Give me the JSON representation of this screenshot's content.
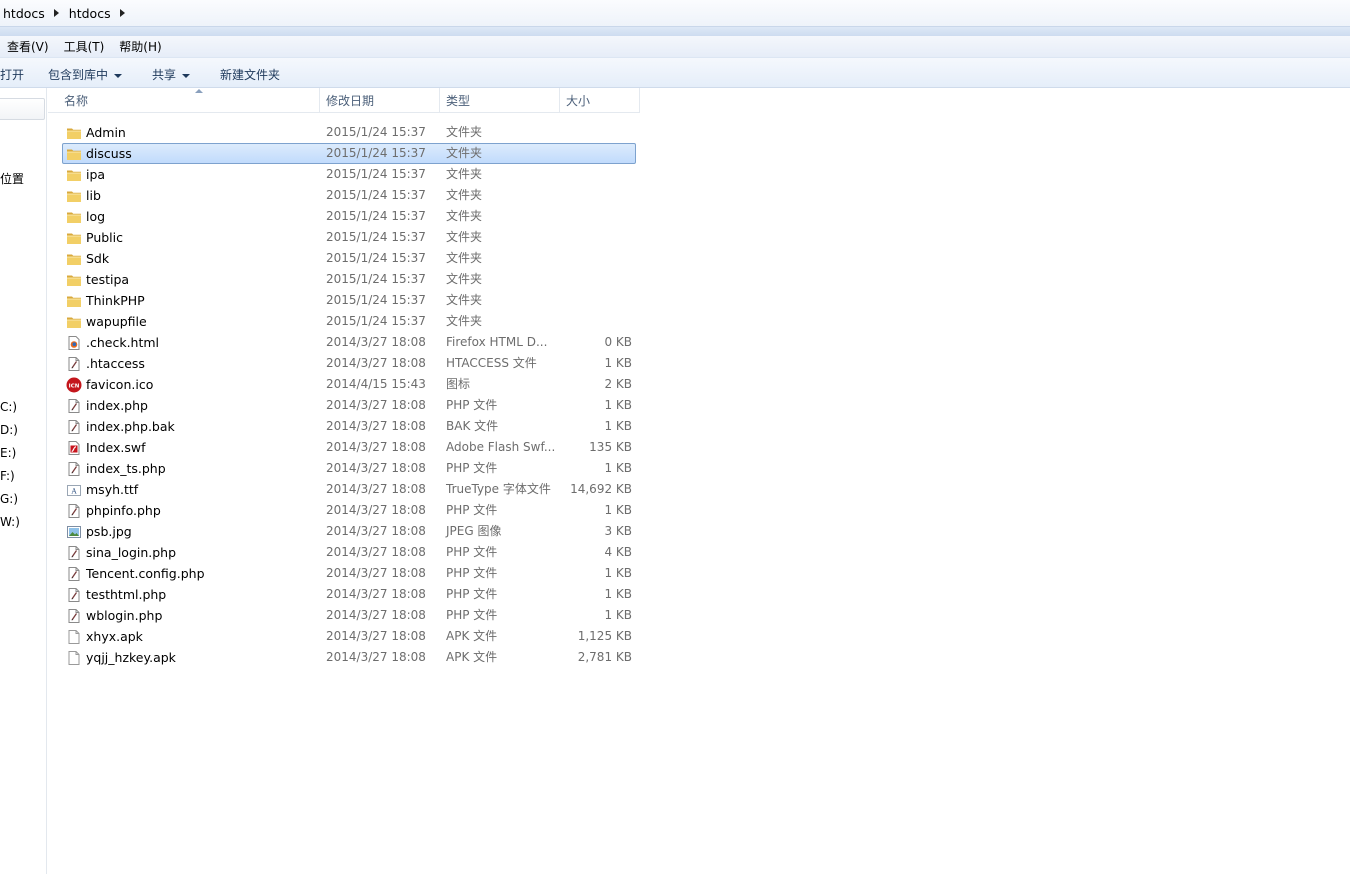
{
  "breadcrumb": {
    "items": [
      "htdocs",
      "htdocs"
    ]
  },
  "menu": {
    "items": [
      "查看(V)",
      "工具(T)",
      "帮助(H)"
    ]
  },
  "toolbar": {
    "open_label": "打开",
    "include_label": "包含到库中",
    "share_label": "共享",
    "new_folder_label": "新建文件夹"
  },
  "nav": {
    "location_label": "位置",
    "drives": [
      "C:)",
      "D:)",
      "E:)",
      "F:)",
      "G:)",
      "W:)"
    ]
  },
  "columns": {
    "name": "名称",
    "date": "修改日期",
    "type": "类型",
    "size": "大小"
  },
  "files": [
    {
      "name": "Admin",
      "date": "2015/1/24 15:37",
      "type": "文件夹",
      "size": "",
      "icon": "folder-icon"
    },
    {
      "name": "discuss",
      "date": "2015/1/24 15:37",
      "type": "文件夹",
      "size": "",
      "icon": "folder-icon",
      "selected": true
    },
    {
      "name": "ipa",
      "date": "2015/1/24 15:37",
      "type": "文件夹",
      "size": "",
      "icon": "folder-icon"
    },
    {
      "name": "lib",
      "date": "2015/1/24 15:37",
      "type": "文件夹",
      "size": "",
      "icon": "folder-icon"
    },
    {
      "name": "log",
      "date": "2015/1/24 15:37",
      "type": "文件夹",
      "size": "",
      "icon": "folder-icon"
    },
    {
      "name": "Public",
      "date": "2015/1/24 15:37",
      "type": "文件夹",
      "size": "",
      "icon": "folder-icon"
    },
    {
      "name": "Sdk",
      "date": "2015/1/24 15:37",
      "type": "文件夹",
      "size": "",
      "icon": "folder-icon"
    },
    {
      "name": "testipa",
      "date": "2015/1/24 15:37",
      "type": "文件夹",
      "size": "",
      "icon": "folder-icon"
    },
    {
      "name": "ThinkPHP",
      "date": "2015/1/24 15:37",
      "type": "文件夹",
      "size": "",
      "icon": "folder-icon"
    },
    {
      "name": "wapupfile",
      "date": "2015/1/24 15:37",
      "type": "文件夹",
      "size": "",
      "icon": "folder-icon"
    },
    {
      "name": ".check.html",
      "date": "2014/3/27 18:08",
      "type": "Firefox HTML D...",
      "size": "0 KB",
      "icon": "firefox-html-icon"
    },
    {
      "name": ".htaccess",
      "date": "2014/3/27 18:08",
      "type": "HTACCESS 文件",
      "size": "1 KB",
      "icon": "script-file-icon"
    },
    {
      "name": "favicon.ico",
      "date": "2014/4/15 15:43",
      "type": "图标",
      "size": "2 KB",
      "icon": "ico-file-icon"
    },
    {
      "name": "index.php",
      "date": "2014/3/27 18:08",
      "type": "PHP 文件",
      "size": "1 KB",
      "icon": "script-file-icon"
    },
    {
      "name": "index.php.bak",
      "date": "2014/3/27 18:08",
      "type": "BAK 文件",
      "size": "1 KB",
      "icon": "script-file-icon"
    },
    {
      "name": "Index.swf",
      "date": "2014/3/27 18:08",
      "type": "Adobe Flash Swf...",
      "size": "135 KB",
      "icon": "flash-file-icon"
    },
    {
      "name": "index_ts.php",
      "date": "2014/3/27 18:08",
      "type": "PHP 文件",
      "size": "1 KB",
      "icon": "script-file-icon"
    },
    {
      "name": "msyh.ttf",
      "date": "2014/3/27 18:08",
      "type": "TrueType 字体文件",
      "size": "14,692 KB",
      "icon": "font-file-icon"
    },
    {
      "name": "phpinfo.php",
      "date": "2014/3/27 18:08",
      "type": "PHP 文件",
      "size": "1 KB",
      "icon": "script-file-icon"
    },
    {
      "name": "psb.jpg",
      "date": "2014/3/27 18:08",
      "type": "JPEG 图像",
      "size": "3 KB",
      "icon": "image-file-icon"
    },
    {
      "name": "sina_login.php",
      "date": "2014/3/27 18:08",
      "type": "PHP 文件",
      "size": "4 KB",
      "icon": "script-file-icon"
    },
    {
      "name": "Tencent.config.php",
      "date": "2014/3/27 18:08",
      "type": "PHP 文件",
      "size": "1 KB",
      "icon": "script-file-icon"
    },
    {
      "name": "testhtml.php",
      "date": "2014/3/27 18:08",
      "type": "PHP 文件",
      "size": "1 KB",
      "icon": "script-file-icon"
    },
    {
      "name": "wblogin.php",
      "date": "2014/3/27 18:08",
      "type": "PHP 文件",
      "size": "1 KB",
      "icon": "script-file-icon"
    },
    {
      "name": "xhyx.apk",
      "date": "2014/3/27 18:08",
      "type": "APK 文件",
      "size": "1,125 KB",
      "icon": "blank-file-icon"
    },
    {
      "name": "yqjj_hzkey.apk",
      "date": "2014/3/27 18:08",
      "type": "APK 文件",
      "size": "2,781 KB",
      "icon": "blank-file-icon"
    }
  ],
  "colors": {
    "selection_border": "#7da2ce",
    "selection_fill": "#cde3fc",
    "header_text": "#4c607a",
    "toolbar_text": "#1e395b",
    "folder_yellow": "#e8c25a"
  }
}
